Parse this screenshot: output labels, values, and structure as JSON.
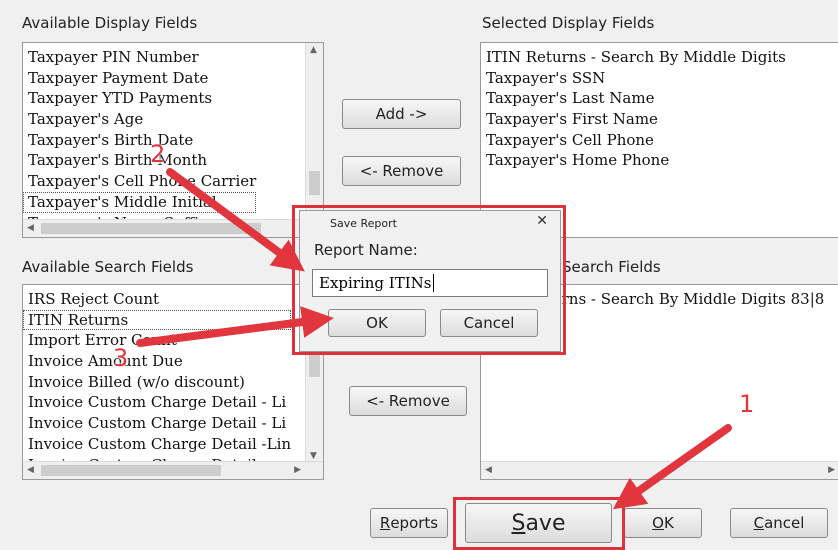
{
  "labels": {
    "available_display": "Available Display Fields",
    "selected_display": "Selected Display Fields",
    "available_search": "Available Search Fields",
    "selected_search": "Search Fields"
  },
  "available_display_fields": [
    "Taxpayer PIN Number",
    "Taxpayer Payment Date",
    "Taxpayer YTD Payments",
    "Taxpayer's Age",
    "Taxpayer's Birth Date",
    "Taxpayer's Birth Month",
    "Taxpayer's Cell Phone Carrier",
    "Taxpayer's Middle Initial",
    "Taxpayer's Name Suffix"
  ],
  "selected_display_fields": [
    "ITIN Returns - Search By Middle Digits",
    "Taxpayer's SSN",
    "Taxpayer's Last Name",
    "Taxpayer's First Name",
    "Taxpayer's Cell Phone",
    "Taxpayer's Home Phone"
  ],
  "available_search_fields": [
    "IRS Reject Count",
    "ITIN Returns",
    "Import Error Count",
    "Invoice Amount Due",
    "Invoice Billed (w/o discount)",
    "Invoice Custom Charge Detail - Li",
    "Invoice Custom Charge Detail - Li",
    "Invoice Custom Charge Detail -Lin",
    "Invoice Custom Charge Detail"
  ],
  "selected_search_fields": [
    "ITIN Returns - Search By Middle Digits  83|8"
  ],
  "buttons": {
    "add_display": "Add ->",
    "remove_display": "<- Remove",
    "remove_search": "<- Remove",
    "reports_prefix": "R",
    "reports_rest": "eports",
    "save_prefix": "S",
    "save_rest": "ave",
    "ok_prefix": "O",
    "ok_rest": "K",
    "cancel_prefix": "C",
    "cancel_rest": "ancel"
  },
  "dialog": {
    "title": "Save Report",
    "close_glyph": "✕",
    "field_label": "Report Name:",
    "field_value": "Expiring ITINs",
    "ok_label": "OK",
    "cancel_label": "Cancel"
  },
  "annotations": {
    "step1": "1",
    "step2": "2",
    "step3": "3"
  },
  "colors": {
    "annotation_red": "#e2363f"
  }
}
